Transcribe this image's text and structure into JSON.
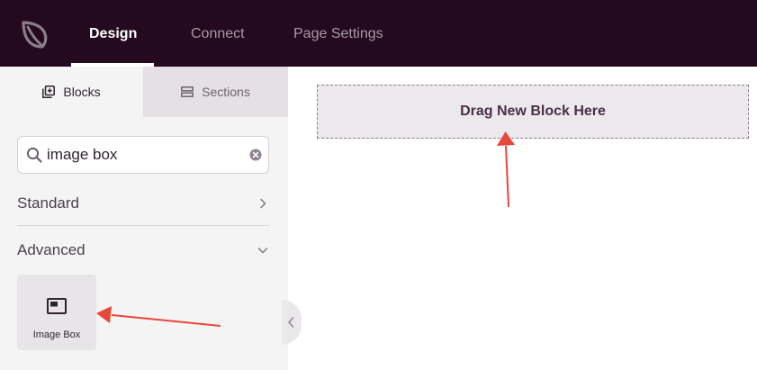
{
  "header": {
    "tabs": [
      {
        "label": "Design",
        "active": true
      },
      {
        "label": "Connect",
        "active": false
      },
      {
        "label": "Page Settings",
        "active": false
      }
    ]
  },
  "sidebar": {
    "tabs": [
      {
        "label": "Blocks",
        "icon": "blocks-icon",
        "active": true
      },
      {
        "label": "Sections",
        "icon": "sections-icon",
        "active": false
      }
    ],
    "search": {
      "value": "image box",
      "placeholder": ""
    },
    "groups": [
      {
        "label": "Standard",
        "expanded": false
      },
      {
        "label": "Advanced",
        "expanded": true
      }
    ],
    "blocks": [
      {
        "label": "Image Box",
        "icon": "image-box-icon"
      }
    ]
  },
  "canvas": {
    "dropzone_label": "Drag New Block Here"
  },
  "colors": {
    "topbar": "#24091f",
    "annotation_arrow": "#e8473b",
    "sidebar_bg": "#f5f4f5"
  }
}
